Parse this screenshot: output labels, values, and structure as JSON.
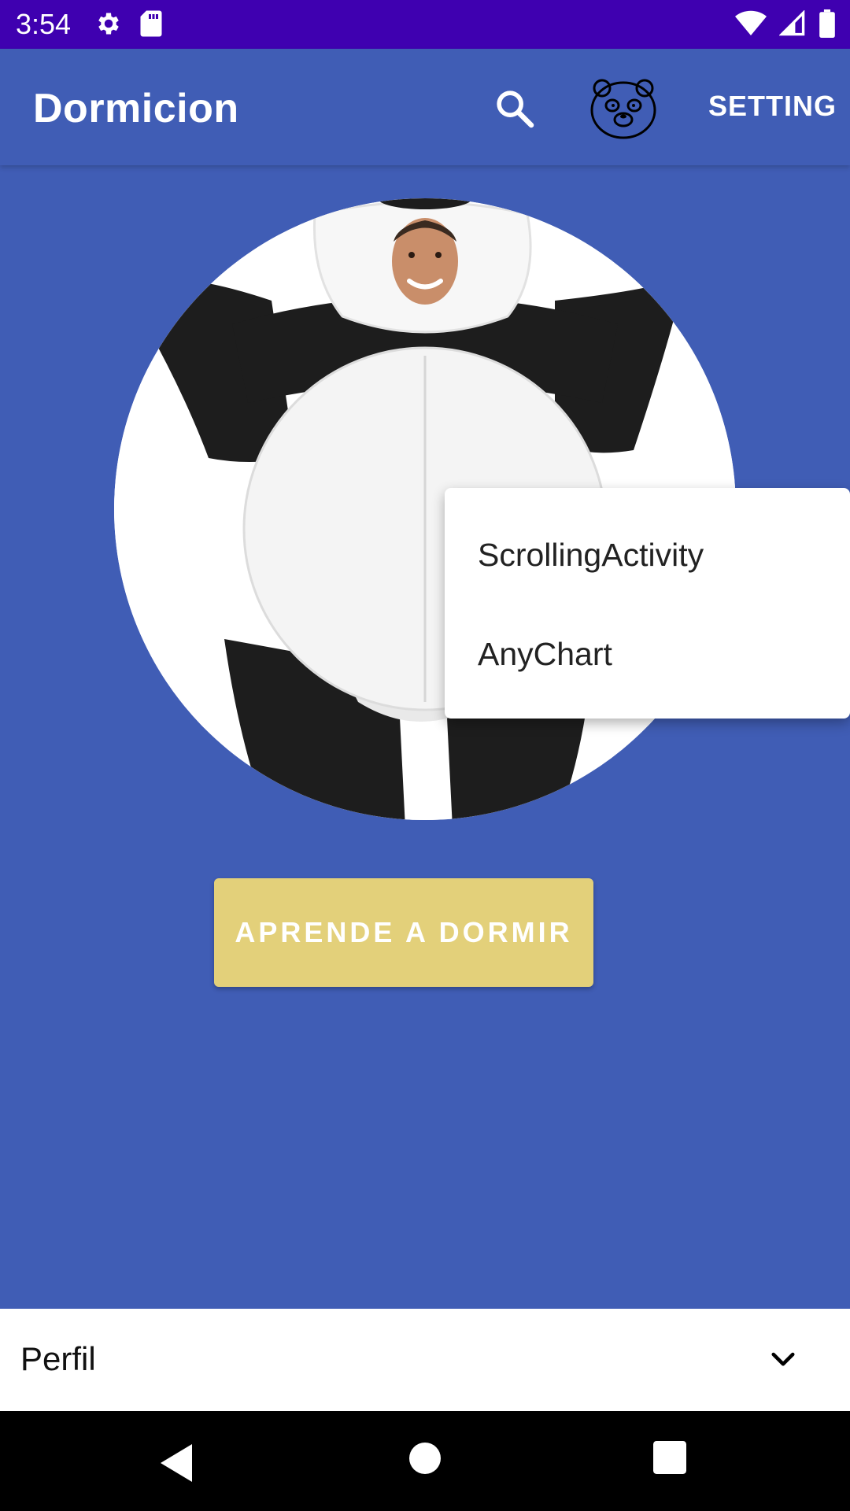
{
  "status_bar": {
    "time": "3:54",
    "left_icons": [
      "gear-icon",
      "sd-card-icon"
    ],
    "right_icons": [
      "wifi-icon",
      "signal-icon",
      "battery-icon"
    ]
  },
  "app_bar": {
    "title": "Dormicion",
    "search_icon": "search-icon",
    "panda_icon": "panda-icon",
    "setting_label": "SETTING"
  },
  "main": {
    "cta_label": "APRENDE A DORMIR"
  },
  "popup_menu": {
    "items": [
      {
        "label": "ScrollingActivity"
      },
      {
        "label": "AnyChart"
      }
    ]
  },
  "bottom_select": {
    "selected": "Perfil"
  },
  "nav_bar": {
    "icons": [
      "back-icon",
      "home-icon",
      "recents-icon"
    ]
  },
  "colors": {
    "status_bar": "#3F00B0",
    "primary": "#405DB5",
    "accent_button": "#E3D07A"
  }
}
